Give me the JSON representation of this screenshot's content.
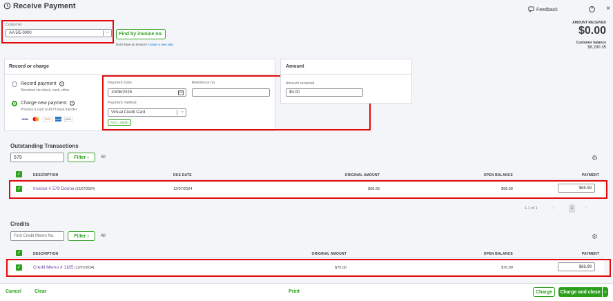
{
  "header": {
    "title": "Receive Payment",
    "feedback": "Feedback",
    "amount_received_label": "AMOUNT RECEIVED",
    "amount_received_value": "$0.00",
    "customer_balance_label": "Customer balance",
    "customer_balance_value": "$8,290.35"
  },
  "customer": {
    "label": "Customer",
    "value": "AA 5/5 0000",
    "find_invoice_button": "Find by invoice no.",
    "no_invoice_text": "Don't have an invoice?",
    "create_sale_link": "Create a new sale"
  },
  "record_or_charge": {
    "title": "Record or charge",
    "record_payment_label": "Record payment",
    "record_payment_sub": "Received via check, cash, other",
    "charge_payment_label": "Charge new payment",
    "charge_payment_sub": "Process a card or ACH bank transfer",
    "selected": "charge",
    "card_brands": [
      "VISA",
      "MC",
      "DISC",
      "AMEX",
      "ACH"
    ]
  },
  "payment": {
    "date_label": "Payment Date",
    "date_value": "10/06/2025",
    "reference_label": "Reference no.",
    "reference_value": "",
    "method_label": "Payment method",
    "method_value": "Virtual Credit Card",
    "badge": "Ach (...0000)"
  },
  "amount": {
    "title": "Amount",
    "received_label": "Amount received",
    "received_value": "$0.00"
  },
  "outstanding": {
    "title": "Outstanding Transactions",
    "search_value": "579",
    "filter_label": "Filter",
    "all_label": "All",
    "columns": [
      "DESCRIPTION",
      "DUE DATE",
      "ORIGINAL AMOUNT",
      "OPEN BALANCE",
      "PAYMENT"
    ],
    "rows": [
      {
        "link": "Invoice # 579 Donne",
        "date_suffix": "(12/07/2024)",
        "due_date": "12/07/2024",
        "original": "$68.99",
        "open": "$68.99",
        "payment": "$68.99"
      }
    ],
    "pagination_text": "1-1 of 1",
    "pagination_page": "1"
  },
  "credits": {
    "title": "Credits",
    "search_placeholder": "Find Credit Memo No.",
    "filter_label": "Filter",
    "all_label": "All",
    "columns": [
      "DESCRIPTION",
      "ORIGINAL AMOUNT",
      "OPEN BALANCE",
      "PAYMENT"
    ],
    "rows": [
      {
        "link": "Credit Memo # 1185",
        "date_suffix": "(12/07/2024)",
        "original": "$70.00",
        "open": "$70.00",
        "payment": "$68.99"
      }
    ]
  },
  "footer": {
    "cancel": "Cancel",
    "clear": "Clear",
    "print": "Print",
    "charge": "Charge",
    "charge_and_close": "Charge and close"
  }
}
